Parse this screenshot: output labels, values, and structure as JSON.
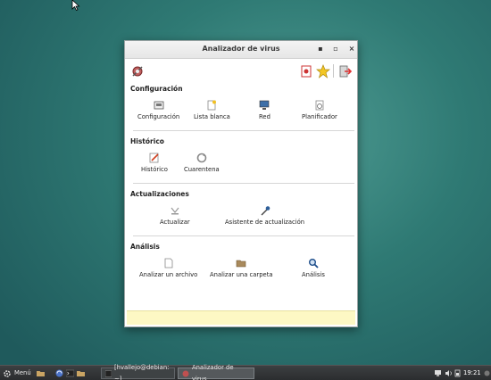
{
  "window": {
    "title": "Analizador de virus",
    "buttons": {
      "minimize": "▪",
      "maximize": "▫",
      "close": "×"
    }
  },
  "toolbar": {
    "left_icon": "scan-settings-icon",
    "right_icons": [
      "report-icon",
      "star-icon",
      "exit-icon"
    ]
  },
  "sections": [
    {
      "title": "Configuración",
      "items": [
        {
          "label": "Configuración",
          "icon": "config-icon"
        },
        {
          "label": "Lista blanca",
          "icon": "whitelist-icon"
        },
        {
          "label": "Red",
          "icon": "network-icon"
        },
        {
          "label": "Planificador",
          "icon": "scheduler-icon"
        }
      ]
    },
    {
      "title": "Histórico",
      "items": [
        {
          "label": "Histórico",
          "icon": "history-icon"
        },
        {
          "label": "Cuarentena",
          "icon": "quarantine-icon"
        }
      ]
    },
    {
      "title": "Actualizaciones",
      "items": [
        {
          "label": "Actualizar",
          "icon": "update-icon"
        },
        {
          "label": "Asistente de actualización",
          "icon": "update-wizard-icon"
        }
      ]
    },
    {
      "title": "Análisis",
      "items": [
        {
          "label": "Analizar un archivo",
          "icon": "file-icon"
        },
        {
          "label": "Analizar una carpeta",
          "icon": "folder-icon"
        },
        {
          "label": "Análisis",
          "icon": "magnifier-icon"
        }
      ]
    }
  ],
  "taskbar": {
    "menu_label": "Menú",
    "tasks": [
      {
        "label": "[hvallejo@debian: ~]",
        "active": false
      },
      {
        "label": "Analizador de virus",
        "active": true
      }
    ],
    "clock": "19:21"
  },
  "colors": {
    "accent": "#2f7a74",
    "status_area": "#fdf8c4"
  }
}
